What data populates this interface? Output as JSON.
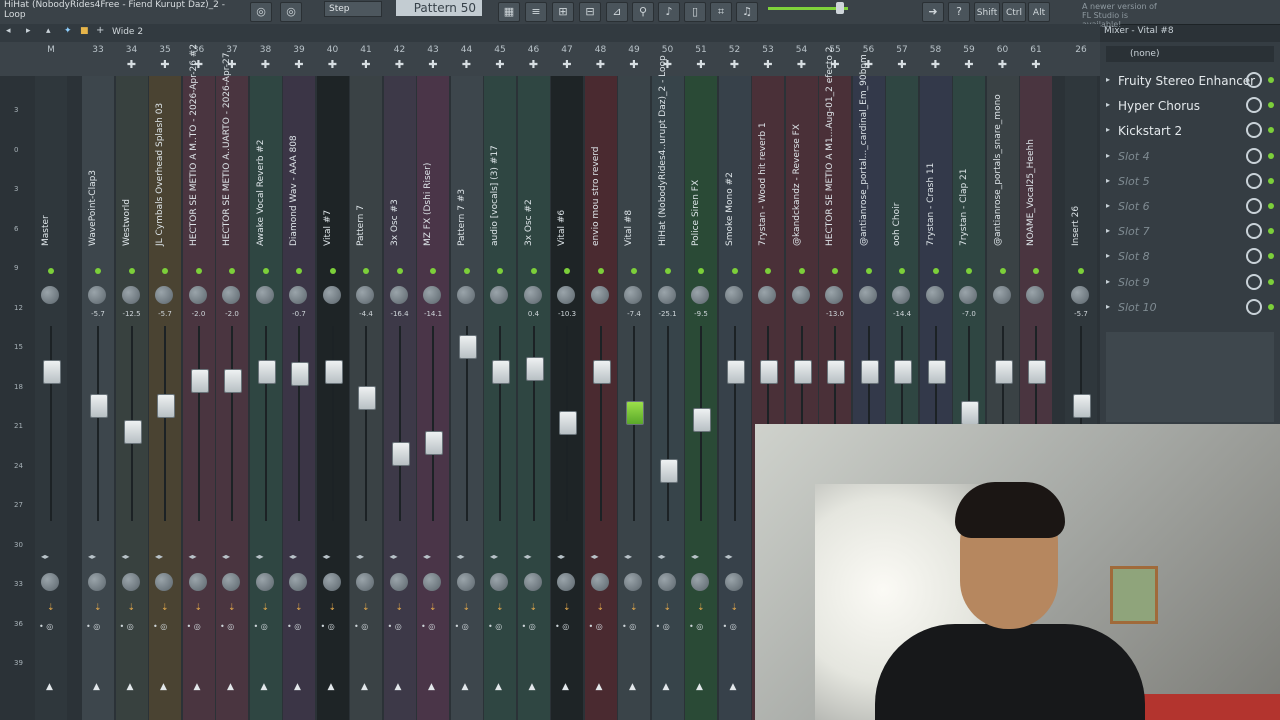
{
  "titlebar": {
    "title_line1": "HiHat (NobodyRides4Free - Fiend Kurupt Daz)_2 -",
    "title_line2": "Loop"
  },
  "toolbar": {
    "step_label": "Step",
    "pattern_label": "Pattern 50",
    "shift_label": "Shift",
    "ctrl_label": "Ctrl",
    "alt_label": "Alt",
    "update_notice": "A newer version of FL Studio is available!"
  },
  "mixer": {
    "preset_label": "Wide 2",
    "panel_title": "Mixer - Vital #8",
    "fx_header": "(none)",
    "fx_slots": [
      {
        "name": "Fruity Stereo Enhancer",
        "empty": false
      },
      {
        "name": "Hyper Chorus",
        "empty": false
      },
      {
        "name": "Kickstart 2",
        "empty": false
      },
      {
        "name": "Slot 4",
        "empty": true
      },
      {
        "name": "Slot 5",
        "empty": true
      },
      {
        "name": "Slot 6",
        "empty": true
      },
      {
        "name": "Slot 7",
        "empty": true
      },
      {
        "name": "Slot 8",
        "empty": true
      },
      {
        "name": "Slot 9",
        "empty": true
      },
      {
        "name": "Slot 10",
        "empty": true
      }
    ],
    "scale_labels": [
      "3",
      "0",
      "3",
      "6",
      "9",
      "12",
      "15",
      "18",
      "21",
      "24",
      "27",
      "30",
      "33",
      "36",
      "39"
    ],
    "tracks": [
      {
        "num": "M",
        "name": "Master",
        "value": "",
        "fader": 0.2,
        "color": "#2f373c"
      },
      {
        "num": "33",
        "name": "WavePoint-Clap3",
        "value": "-5.7",
        "fader": 0.4,
        "color": "#3d464c"
      },
      {
        "num": "34",
        "name": "Westworld",
        "value": "-12.5",
        "fader": 0.55,
        "color": "#38413f"
      },
      {
        "num": "35",
        "name": "JL Cymbals Overhead Splash 03",
        "value": "-5.7",
        "fader": 0.4,
        "color": "#4a4332"
      },
      {
        "num": "36",
        "name": "HECTOR SE METIO A M..TO - 2026-Apr-26 #2",
        "value": "-2.0",
        "fader": 0.25,
        "color": "#4a3540"
      },
      {
        "num": "37",
        "name": "HECTOR SE METIO A..UARTO - 2026-Apr-27",
        "value": "-2.0",
        "fader": 0.25,
        "color": "#4a3540"
      },
      {
        "num": "38",
        "name": "Awake Vocal Reverb #2",
        "value": "",
        "fader": 0.2,
        "color": "#2f4642"
      },
      {
        "num": "39",
        "name": "Diamond Wav - AAA 808",
        "value": "-0.7",
        "fader": 0.21,
        "color": "#3b3546"
      },
      {
        "num": "40",
        "name": "Vital #7",
        "value": "",
        "fader": 0.2,
        "color": "#1e2426"
      },
      {
        "num": "41",
        "name": "Pattern 7",
        "value": "-4.4",
        "fader": 0.35,
        "color": "#3a4245"
      },
      {
        "num": "42",
        "name": "3x Osc #3",
        "value": "-16.4",
        "fader": 0.68,
        "color": "#3d3948"
      },
      {
        "num": "43",
        "name": "MZ FX (Dshi Riser)",
        "value": "-14.1",
        "fader": 0.62,
        "color": "#4a3548"
      },
      {
        "num": "44",
        "name": "Pattern 7 #3",
        "value": "",
        "fader": 0.05,
        "color": "#3d464c"
      },
      {
        "num": "45",
        "name": "audio [vocals] (3) #17",
        "value": "",
        "fader": 0.2,
        "color": "#2f4642"
      },
      {
        "num": "46",
        "name": "3x Osc #2",
        "value": "0.4",
        "fader": 0.18,
        "color": "#2f4642"
      },
      {
        "num": "47",
        "name": "Vital #6",
        "value": "-10.3",
        "fader": 0.5,
        "color": "#1e2426"
      },
      {
        "num": "48",
        "name": "envio mou stro reverd",
        "value": "",
        "fader": 0.2,
        "color": "#4a2a30"
      },
      {
        "num": "49",
        "name": "Vital #8",
        "value": "-7.4",
        "fader": 0.44,
        "color": "#3a4449"
      },
      {
        "num": "50",
        "name": "HiHat (NobodyRides4..urupt Daz)_2 - Loop",
        "value": "-25.1",
        "fader": 0.78,
        "color": "#37444a"
      },
      {
        "num": "51",
        "name": "Police Siren FX",
        "value": "-9.5",
        "fader": 0.48,
        "color": "#2a4a36"
      },
      {
        "num": "52",
        "name": "Smoke Mono #2",
        "value": "",
        "fader": 0.2,
        "color": "#37414a"
      },
      {
        "num": "53",
        "name": "7rystan - Wood hit reverb 1",
        "value": "",
        "fader": 0.2,
        "color": "#4a3038"
      },
      {
        "num": "54",
        "name": "@kandckandz - Reverse FX",
        "value": "",
        "fader": 0.2,
        "color": "#4a3038"
      },
      {
        "num": "55",
        "name": "HECTOR SE METIO A M1...Aug-01_2 efecto 2",
        "value": "-13.0",
        "fader": 0.2,
        "color": "#4a3038"
      },
      {
        "num": "56",
        "name": "@antianrose_portal..._cardinal_Em_90bpm",
        "value": "",
        "fader": 0.2,
        "color": "#33394a"
      },
      {
        "num": "57",
        "name": "ooh Choir",
        "value": "-14.4",
        "fader": 0.2,
        "color": "#2f4642"
      },
      {
        "num": "58",
        "name": "7rystan - Crash 11",
        "value": "",
        "fader": 0.2,
        "color": "#33394a"
      },
      {
        "num": "59",
        "name": "7rystan - Clap 21",
        "value": "-7.0",
        "fader": 0.44,
        "color": "#2f4642"
      },
      {
        "num": "60",
        "name": "@antianrose_portals_snare_mono",
        "value": "",
        "fader": 0.2,
        "color": "#3a4245"
      },
      {
        "num": "61",
        "name": "NOAME_Vocal25_Heehh",
        "value": "",
        "fader": 0.2,
        "color": "#4a3540"
      },
      {
        "num": "26",
        "name": "Insert 26",
        "value": "-5.7",
        "fader": 0.4,
        "color": "#2f373c"
      }
    ]
  }
}
